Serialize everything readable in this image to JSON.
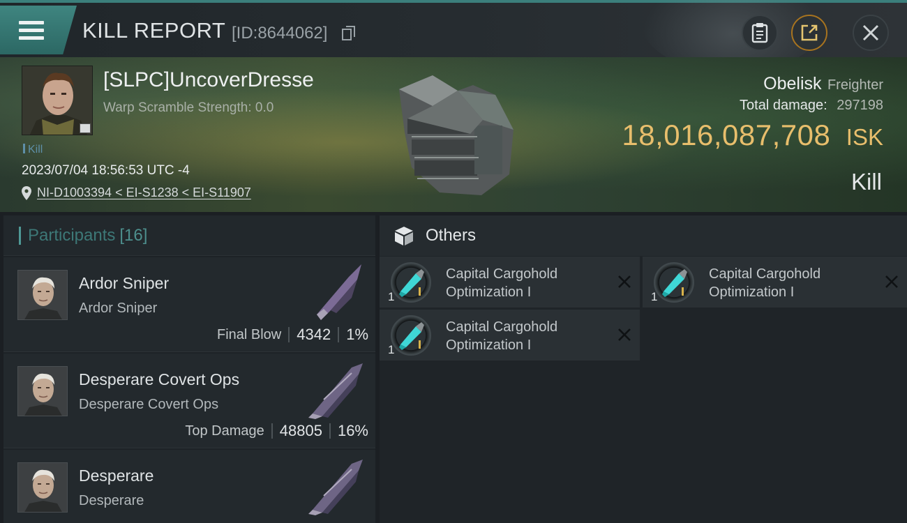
{
  "header": {
    "title": "KILL REPORT",
    "report_id": "[ID:8644062]"
  },
  "victim": {
    "name": "[SLPC]UncoverDresse",
    "warp_scramble": "Warp Scramble Strength: 0.0",
    "tag": "Kill",
    "datetime": "2023/07/04 18:56:53 UTC -4",
    "location": "NI-D1003394 < EI-S1238 < EI-S11907",
    "ship_name": "Obelisk",
    "ship_class": "Freighter",
    "total_damage_label": "Total damage:",
    "total_damage": "297198",
    "isk_value": "18,016,087,708",
    "isk_unit": "ISK",
    "result": "Kill"
  },
  "participants": {
    "label": "Participants",
    "count": "[16]",
    "rows": [
      {
        "name": "Ardor Sniper",
        "ship": "Ardor Sniper",
        "role": "Final Blow",
        "damage": "4342",
        "percent": "1%"
      },
      {
        "name": "Desperare Covert Ops",
        "ship": "Desperare Covert Ops",
        "role": "Top Damage",
        "damage": "48805",
        "percent": "16%"
      },
      {
        "name": "Desperare",
        "ship": "Desperare",
        "role": "",
        "damage": "",
        "percent": ""
      }
    ]
  },
  "others": {
    "label": "Others",
    "items": [
      {
        "name": "Capital Cargohold Optimization I",
        "qty": "1"
      },
      {
        "name": "Capital Cargohold Optimization I",
        "qty": "1"
      },
      {
        "name": "Capital Cargohold Optimization I",
        "qty": "1"
      }
    ]
  },
  "colors": {
    "accent_teal": "#3f8580",
    "isk_gold": "#e8be6c",
    "background": "#1b1f23"
  },
  "icons": {
    "menu": "menu-icon",
    "copy": "copy-icon",
    "clipboard": "clipboard-icon",
    "share": "share-icon",
    "close": "close-icon",
    "location": "location-pin-icon",
    "others": "cube-icon",
    "remove": "x-icon"
  }
}
